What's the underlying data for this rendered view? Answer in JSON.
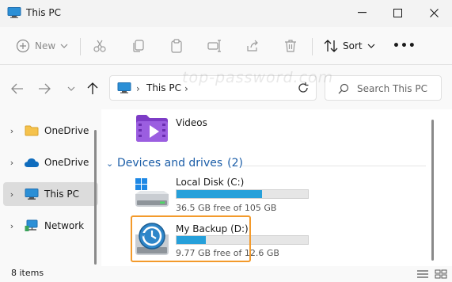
{
  "window": {
    "title": "This PC",
    "minimize_glyph": "—",
    "maximize_glyph": "☐",
    "close_glyph": "✕"
  },
  "toolbar": {
    "new_label": "New",
    "sort_label": "Sort",
    "more_label": "•••",
    "buttons": [
      "new-icon",
      "cut-icon",
      "copy-icon",
      "paste-icon",
      "rename-icon",
      "share-icon",
      "delete-icon",
      "sort-icon"
    ]
  },
  "navigation": {
    "back_glyph": "←",
    "forward_glyph": "→",
    "up_glyph": "↑"
  },
  "address": {
    "chevron": "›",
    "crumb": "This PC",
    "trailing_chevron": "›"
  },
  "search": {
    "placeholder": "Search This PC"
  },
  "watermark": "top-password.com",
  "sidebar": {
    "items": [
      {
        "label": "OneDrive",
        "icon": "folder-icon",
        "selected": false
      },
      {
        "label": "OneDrive",
        "icon": "cloud-icon",
        "selected": false
      },
      {
        "label": "This PC",
        "icon": "computer-icon",
        "selected": true
      },
      {
        "label": "Network",
        "icon": "network-icon",
        "selected": false
      }
    ],
    "chevron": "›"
  },
  "content": {
    "folders": [
      {
        "label": "Videos",
        "icon": "videos-folder-icon"
      }
    ],
    "group": {
      "title": "Devices and drives",
      "count": "(2)",
      "chevron": "⌄"
    },
    "drives": [
      {
        "name": "Local Disk (C:)",
        "free_text": "36.5 GB free of 105 GB",
        "used_fraction": 0.65,
        "icon": "windows-drive-icon"
      },
      {
        "name": "My Backup (D:)",
        "free_text": "9.77 GB free of 12.6 GB",
        "used_fraction": 0.22,
        "icon": "backup-drive-icon",
        "highlighted": true
      }
    ]
  },
  "status": {
    "items_text": "8 items"
  },
  "colors": {
    "accent": "#1c5ea8",
    "drive_bar": "#26a0da",
    "highlight": "#f39a2b"
  }
}
